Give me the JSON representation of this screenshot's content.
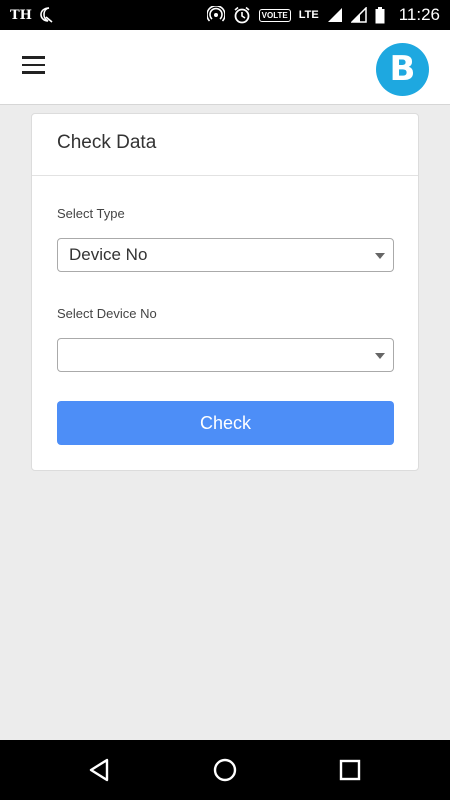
{
  "status_bar": {
    "carrier": "TH",
    "volte": "VOLTE",
    "network": "LTE",
    "time": "11:26"
  },
  "header": {
    "menu_icon": "hamburger-menu-icon",
    "logo_letter": "B",
    "logo_color": "#1ea8e0"
  },
  "card": {
    "title": "Check Data",
    "type_label": "Select Type",
    "type_value": "Device No",
    "device_label": "Select Device No",
    "device_value": "",
    "check_label": "Check",
    "accent_color": "#4d8ef7"
  },
  "nav": {
    "back_icon": "back-triangle-icon",
    "home_icon": "home-circle-icon",
    "recents_icon": "recents-square-icon"
  }
}
